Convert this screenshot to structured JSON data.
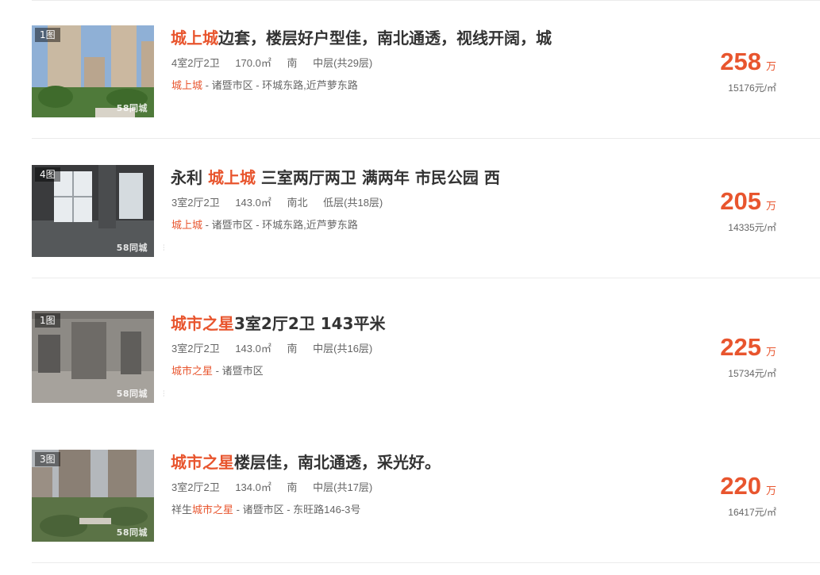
{
  "listings": [
    {
      "photo_count": "1图",
      "watermark": "58同城",
      "title_hl": "城上城",
      "title_rest": "边套，楼层好户型佳，南北通透，视线开阔，城",
      "layout": "4室2厅2卫",
      "area": "170.0㎡",
      "facing": "南",
      "floor": "中层(共29层)",
      "community": "城上城",
      "district": " - 诸暨市区",
      "road": " - 环城东路,近芦萝东路",
      "price": "258",
      "price_unit": "万",
      "unit_price": "15176元/㎡"
    },
    {
      "photo_count": "4图",
      "watermark": "58同城",
      "title_pre": "永利 ",
      "title_hl": "城上城",
      "title_rest": " 三室两厅两卫 满两年 市民公园 西",
      "layout": "3室2厅2卫",
      "area": "143.0㎡",
      "facing": "南北",
      "floor": "低层(共18层)",
      "community": "城上城",
      "district": " - 诸暨市区",
      "road": " - 环城东路,近芦萝东路",
      "price": "205",
      "price_unit": "万",
      "unit_price": "14335元/㎡"
    },
    {
      "photo_count": "1图",
      "watermark": "58同城",
      "title_hl": "城市之星",
      "title_rest": "3室2厅2卫 143平米",
      "layout": "3室2厅2卫",
      "area": "143.0㎡",
      "facing": "南",
      "floor": "中层(共16层)",
      "community": "城市之星",
      "district": " - 诸暨市区",
      "price": "225",
      "price_unit": "万",
      "unit_price": "15734元/㎡"
    },
    {
      "photo_count": "3图",
      "watermark": "58同城",
      "title_hl": "城市之星",
      "title_rest": "楼层佳，南北通透，采光好。",
      "layout": "3室2厅2卫",
      "area": "134.0㎡",
      "facing": "南",
      "floor": "中层(共17层)",
      "community_pre": "祥生",
      "community": "城市之星",
      "district": " - 诸暨市区",
      "road": " - 东旺路146-3号",
      "price": "220",
      "price_unit": "万",
      "unit_price": "16417元/㎡"
    }
  ]
}
